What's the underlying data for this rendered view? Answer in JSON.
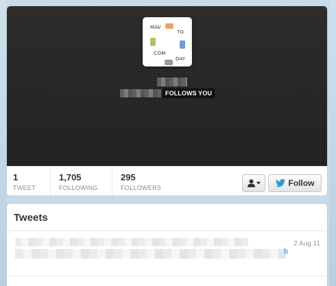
{
  "profile": {
    "avatar_logo": {
      "word1": "MAV",
      "word2": "TO",
      "word3": ".COM",
      "word4": "DAY"
    },
    "follows_badge": "FOLLOWS YOU"
  },
  "stats": [
    {
      "value": "1",
      "label": "TWEET"
    },
    {
      "value": "1,705",
      "label": "FOLLOWING"
    },
    {
      "value": "295",
      "label": "FOLLOWERS"
    }
  ],
  "actions": {
    "follow_label": "Follow",
    "user_menu_icon": "person-icon",
    "follow_icon": "bird-icon",
    "accent_color": "#2a9ad8"
  },
  "tweets": {
    "title": "Tweets",
    "items": [
      {
        "date": "2 Aug 11",
        "link_char": "اı"
      }
    ]
  }
}
